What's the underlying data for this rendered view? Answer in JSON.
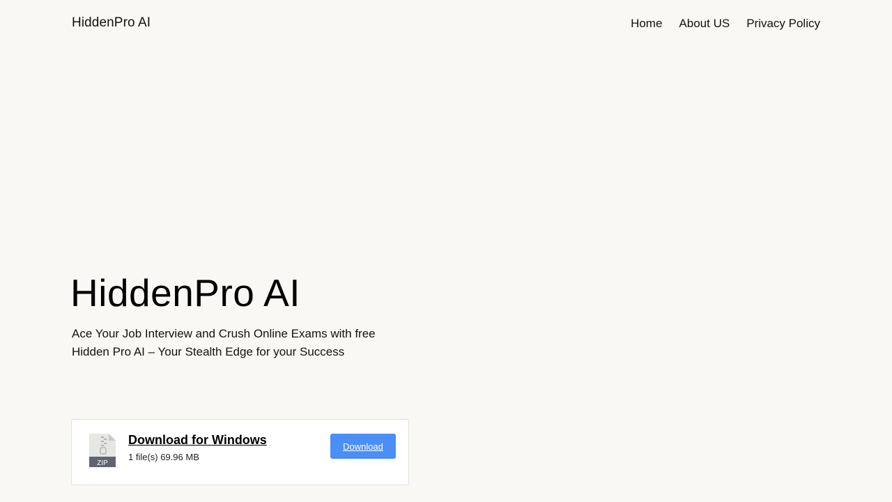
{
  "header": {
    "site_title": "HiddenPro AI",
    "nav": [
      {
        "label": "Home"
      },
      {
        "label": "About US"
      },
      {
        "label": "Privacy Policy"
      }
    ]
  },
  "hero": {
    "title": "HiddenPro AI",
    "subtitle": "Ace Your Job Interview and Crush Online Exams with free Hidden Pro AI – Your Stealth Edge for your Success"
  },
  "download_card": {
    "icon": "zip-file-icon",
    "icon_label": "ZIP",
    "title": "Download for Windows",
    "meta": "1 file(s) 69.96 MB",
    "button_label": "Download",
    "button_color": "#4a8ef6"
  },
  "colors": {
    "background": "#f9f8f4",
    "text": "#111111"
  }
}
